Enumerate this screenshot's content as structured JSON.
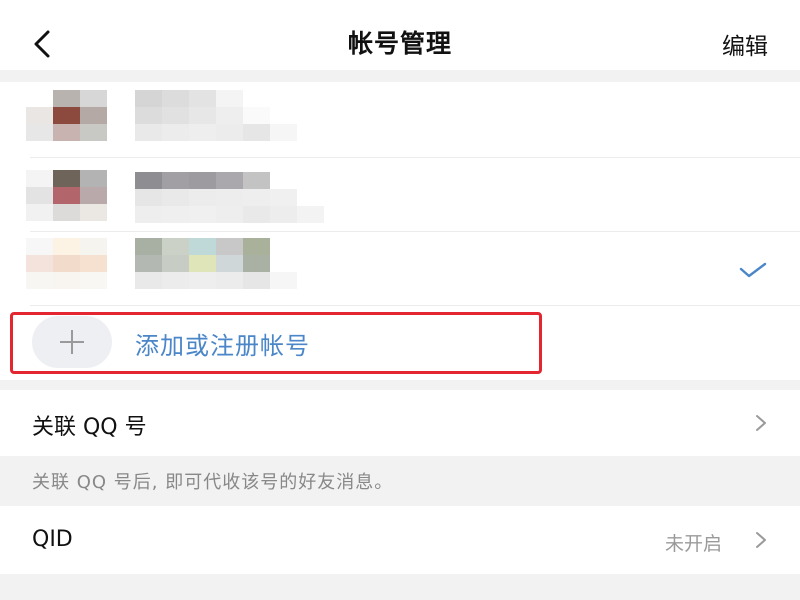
{
  "header": {
    "title": "帐号管理",
    "edit_label": "编辑",
    "back_icon": "chevron-left-icon"
  },
  "accounts": {
    "add_label": "添加或注册帐号",
    "active_index": 2
  },
  "settings": {
    "link_qq_label": "关联 QQ 号",
    "link_qq_hint": "关联 QQ 号后, 即可代收该号的好友消息。",
    "qid_label": "QID",
    "qid_value": "未开启"
  },
  "colors": {
    "accent": "#4a86c8",
    "highlight": "#e3262f"
  }
}
